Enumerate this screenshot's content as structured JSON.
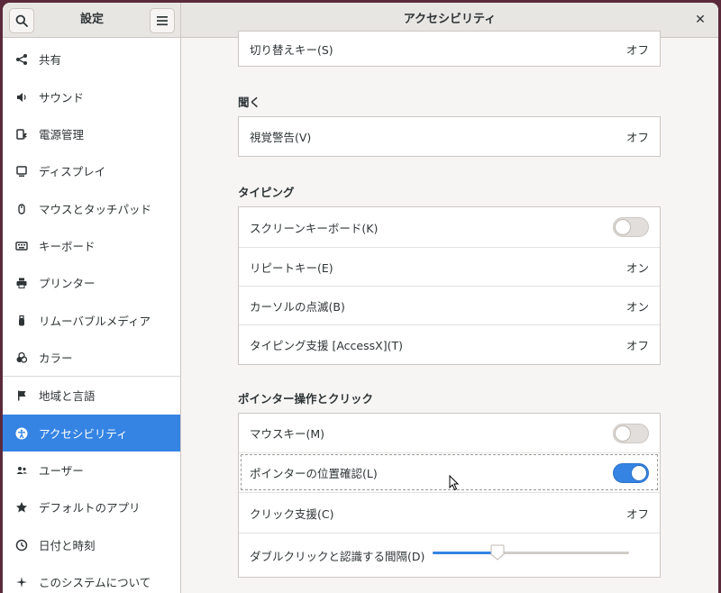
{
  "sidebar_header": {
    "title": "設定"
  },
  "main_header": {
    "title": "アクセシビリティ"
  },
  "sidebar": {
    "items": [
      {
        "label": "共有",
        "icon": "share-icon"
      },
      {
        "label": "サウンド",
        "icon": "speaker-icon"
      },
      {
        "label": "電源管理",
        "icon": "power-icon"
      },
      {
        "label": "ディスプレイ",
        "icon": "display-icon"
      },
      {
        "label": "マウスとタッチパッド",
        "icon": "mouse-icon"
      },
      {
        "label": "キーボード",
        "icon": "keyboard-icon"
      },
      {
        "label": "プリンター",
        "icon": "printer-icon"
      },
      {
        "label": "リムーバブルメディア",
        "icon": "usb-icon"
      },
      {
        "label": "カラー",
        "icon": "color-icon"
      },
      {
        "label": "地域と言語",
        "icon": "flag-icon"
      },
      {
        "label": "アクセシビリティ",
        "icon": "accessibility-icon",
        "active": true
      },
      {
        "label": "ユーザー",
        "icon": "users-icon"
      },
      {
        "label": "デフォルトのアプリ",
        "icon": "star-icon"
      },
      {
        "label": "日付と時刻",
        "icon": "clock-icon"
      },
      {
        "label": "このシステムについて",
        "icon": "info-icon"
      }
    ]
  },
  "main": {
    "top_row": {
      "label": "切り替えキー(S)",
      "value": "オフ"
    },
    "hearing": {
      "title": "聞く",
      "rows": [
        {
          "label": "視覚警告(V)",
          "value": "オフ"
        }
      ]
    },
    "typing": {
      "title": "タイピング",
      "rows": [
        {
          "label": "スクリーンキーボード(K)",
          "switch": false
        },
        {
          "label": "リピートキー(E)",
          "value": "オン"
        },
        {
          "label": "カーソルの点滅(B)",
          "value": "オン"
        },
        {
          "label": "タイピング支援 [AccessX](T)",
          "value": "オフ"
        }
      ]
    },
    "pointing": {
      "title": "ポインター操作とクリック",
      "rows": [
        {
          "label": "マウスキー(M)",
          "switch": false
        },
        {
          "label": "ポインターの位置確認(L)",
          "switch": true
        },
        {
          "label": "クリック支援(C)",
          "value": "オフ"
        },
        {
          "label": "ダブルクリックと認識する間隔(D)",
          "slider_fraction": 0.33
        }
      ]
    }
  },
  "colors": {
    "accent": "#3584e4",
    "sidebar_bg": "#ffffff",
    "content_bg": "#f6f5f4"
  }
}
